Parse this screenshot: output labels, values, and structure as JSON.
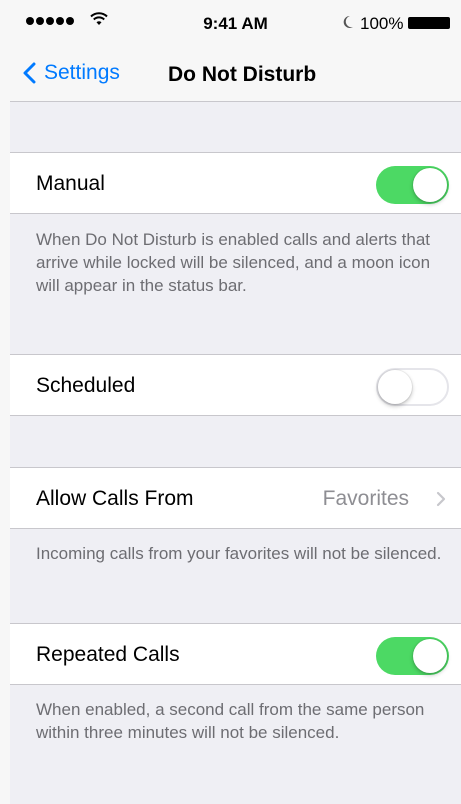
{
  "status_bar": {
    "time": "9:41 AM",
    "battery": "100%"
  },
  "nav": {
    "back_label": "Settings",
    "title": "Do Not Disturb"
  },
  "settings": {
    "manual": {
      "label": "Manual",
      "enabled": true,
      "footer": "When Do Not Disturb is enabled calls and alerts that arrive while locked will be silenced, and a moon icon will appear in the status bar."
    },
    "scheduled": {
      "label": "Scheduled",
      "enabled": false
    },
    "allow_calls": {
      "label": "Allow Calls From",
      "value": "Favorites",
      "footer": "Incoming calls from your favorites will not be silenced."
    },
    "repeated_calls": {
      "label": "Repeated Calls",
      "enabled": true,
      "footer": "When enabled, a second call from the same person within three minutes will not be silenced."
    }
  },
  "colors": {
    "accent": "#007aff",
    "toggle_on": "#4cd964",
    "background": "#efeff4",
    "footer_text": "#6d6d72"
  }
}
